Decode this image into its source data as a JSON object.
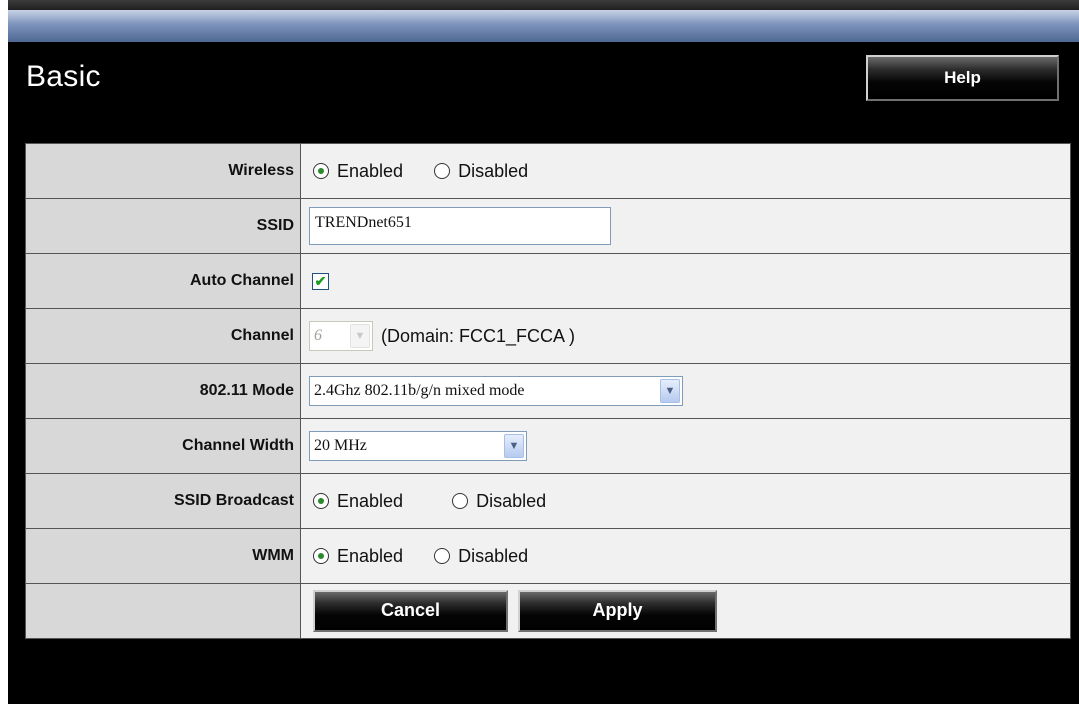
{
  "page": {
    "title": "Basic",
    "help_label": "Help"
  },
  "rows": {
    "wireless": {
      "label": "Wireless",
      "options": [
        "Enabled",
        "Disabled"
      ],
      "selected": "Enabled"
    },
    "ssid": {
      "label": "SSID",
      "value": "TRENDnet651"
    },
    "auto_channel": {
      "label": "Auto Channel",
      "checked": true,
      "check_glyph": "✔"
    },
    "channel": {
      "label": "Channel",
      "value": "6",
      "domain": "(Domain: FCC1_FCCA )"
    },
    "mode": {
      "label": "802.11 Mode",
      "value": "2.4Ghz 802.11b/g/n mixed mode"
    },
    "channel_width": {
      "label": "Channel Width",
      "value": "20 MHz"
    },
    "ssid_broadcast": {
      "label": "SSID Broadcast",
      "options": [
        "Enabled",
        "Disabled"
      ],
      "selected": "Enabled"
    },
    "wmm": {
      "label": "WMM",
      "options": [
        "Enabled",
        "Disabled"
      ],
      "selected": "Enabled"
    }
  },
  "actions": {
    "cancel_label": "Cancel",
    "apply_label": "Apply"
  },
  "icons": {
    "dropdown": "chevron-down-icon",
    "radio": "radio-icon",
    "checkbox": "checkmark-icon"
  },
  "colors": {
    "background": "#000000",
    "label_cell": "#d8d8d8",
    "value_cell": "#f1f1f1",
    "radio_dot": "#2a8a2a",
    "topbar": "#7d93bb"
  }
}
